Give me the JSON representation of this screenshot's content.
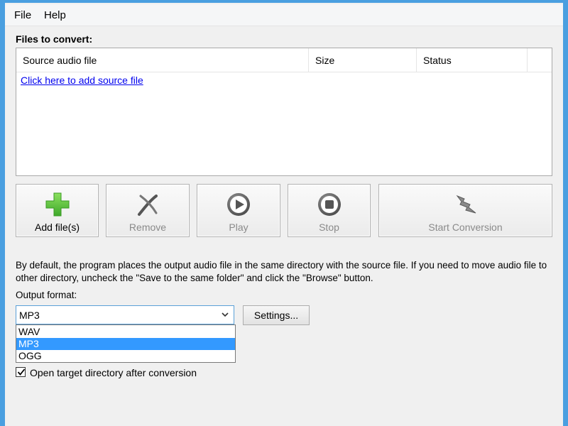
{
  "menu": {
    "file": "File",
    "help": "Help"
  },
  "files_section": {
    "label": "Files to convert:",
    "columns": [
      "Source audio file",
      "Size",
      "Status"
    ],
    "add_link": "Click here to add source file"
  },
  "toolbar": {
    "add": {
      "label": "Add file(s)",
      "icon": "plus-icon"
    },
    "remove": {
      "label": "Remove",
      "icon": "remove-icon"
    },
    "play": {
      "label": "Play",
      "icon": "play-icon"
    },
    "stop": {
      "label": "Stop",
      "icon": "stop-icon"
    },
    "start": {
      "label": "Start Conversion",
      "icon": "convert-icon"
    }
  },
  "info_text": "By default, the program places the output audio file in the same directory with the source file. If you need to move audio file to other directory, uncheck the \"Save to the same folder\" and click the \"Browse\" button.",
  "output": {
    "label": "Output format:",
    "selected": "MP3",
    "options": [
      "WAV",
      "MP3",
      "OGG"
    ],
    "settings_label": "Settings..."
  },
  "open_target": {
    "label": "Open target directory after conversion",
    "checked": true
  },
  "colors": {
    "accent": "#4a9fe0",
    "selection": "#3399ff",
    "link": "#0000ee",
    "add_icon": "#5cc43a"
  }
}
